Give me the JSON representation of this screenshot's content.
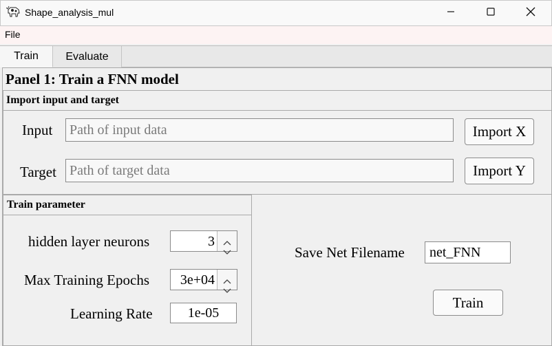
{
  "window": {
    "title": "Shape_analysis_mul"
  },
  "menu": {
    "file": "File"
  },
  "tabs": [
    {
      "label": "Train",
      "active": true
    },
    {
      "label": "Evaluate",
      "active": false
    }
  ],
  "panel": {
    "title": "Panel 1: Train a FNN model"
  },
  "import_section": {
    "title": "Import input and target",
    "input_label": "Input",
    "input_placeholder": "Path of input data",
    "import_x_label": "Import X",
    "target_label": "Target",
    "target_placeholder": "Path of target data",
    "import_y_label": "Import Y"
  },
  "train_params": {
    "title": "Train parameter",
    "hidden_label": "hidden layer neurons",
    "hidden_value": "3",
    "epochs_label": "Max Training Epochs",
    "epochs_value": "3e+04",
    "lr_label": "Learning Rate",
    "lr_value": "1e-05"
  },
  "save": {
    "label": "Save Net Filename",
    "value": "net_FNN",
    "train_button": "Train"
  },
  "icons": {
    "app": "cow-app-icon",
    "minimize": "minimize-icon",
    "maximize": "maximize-icon",
    "close": "close-icon"
  }
}
